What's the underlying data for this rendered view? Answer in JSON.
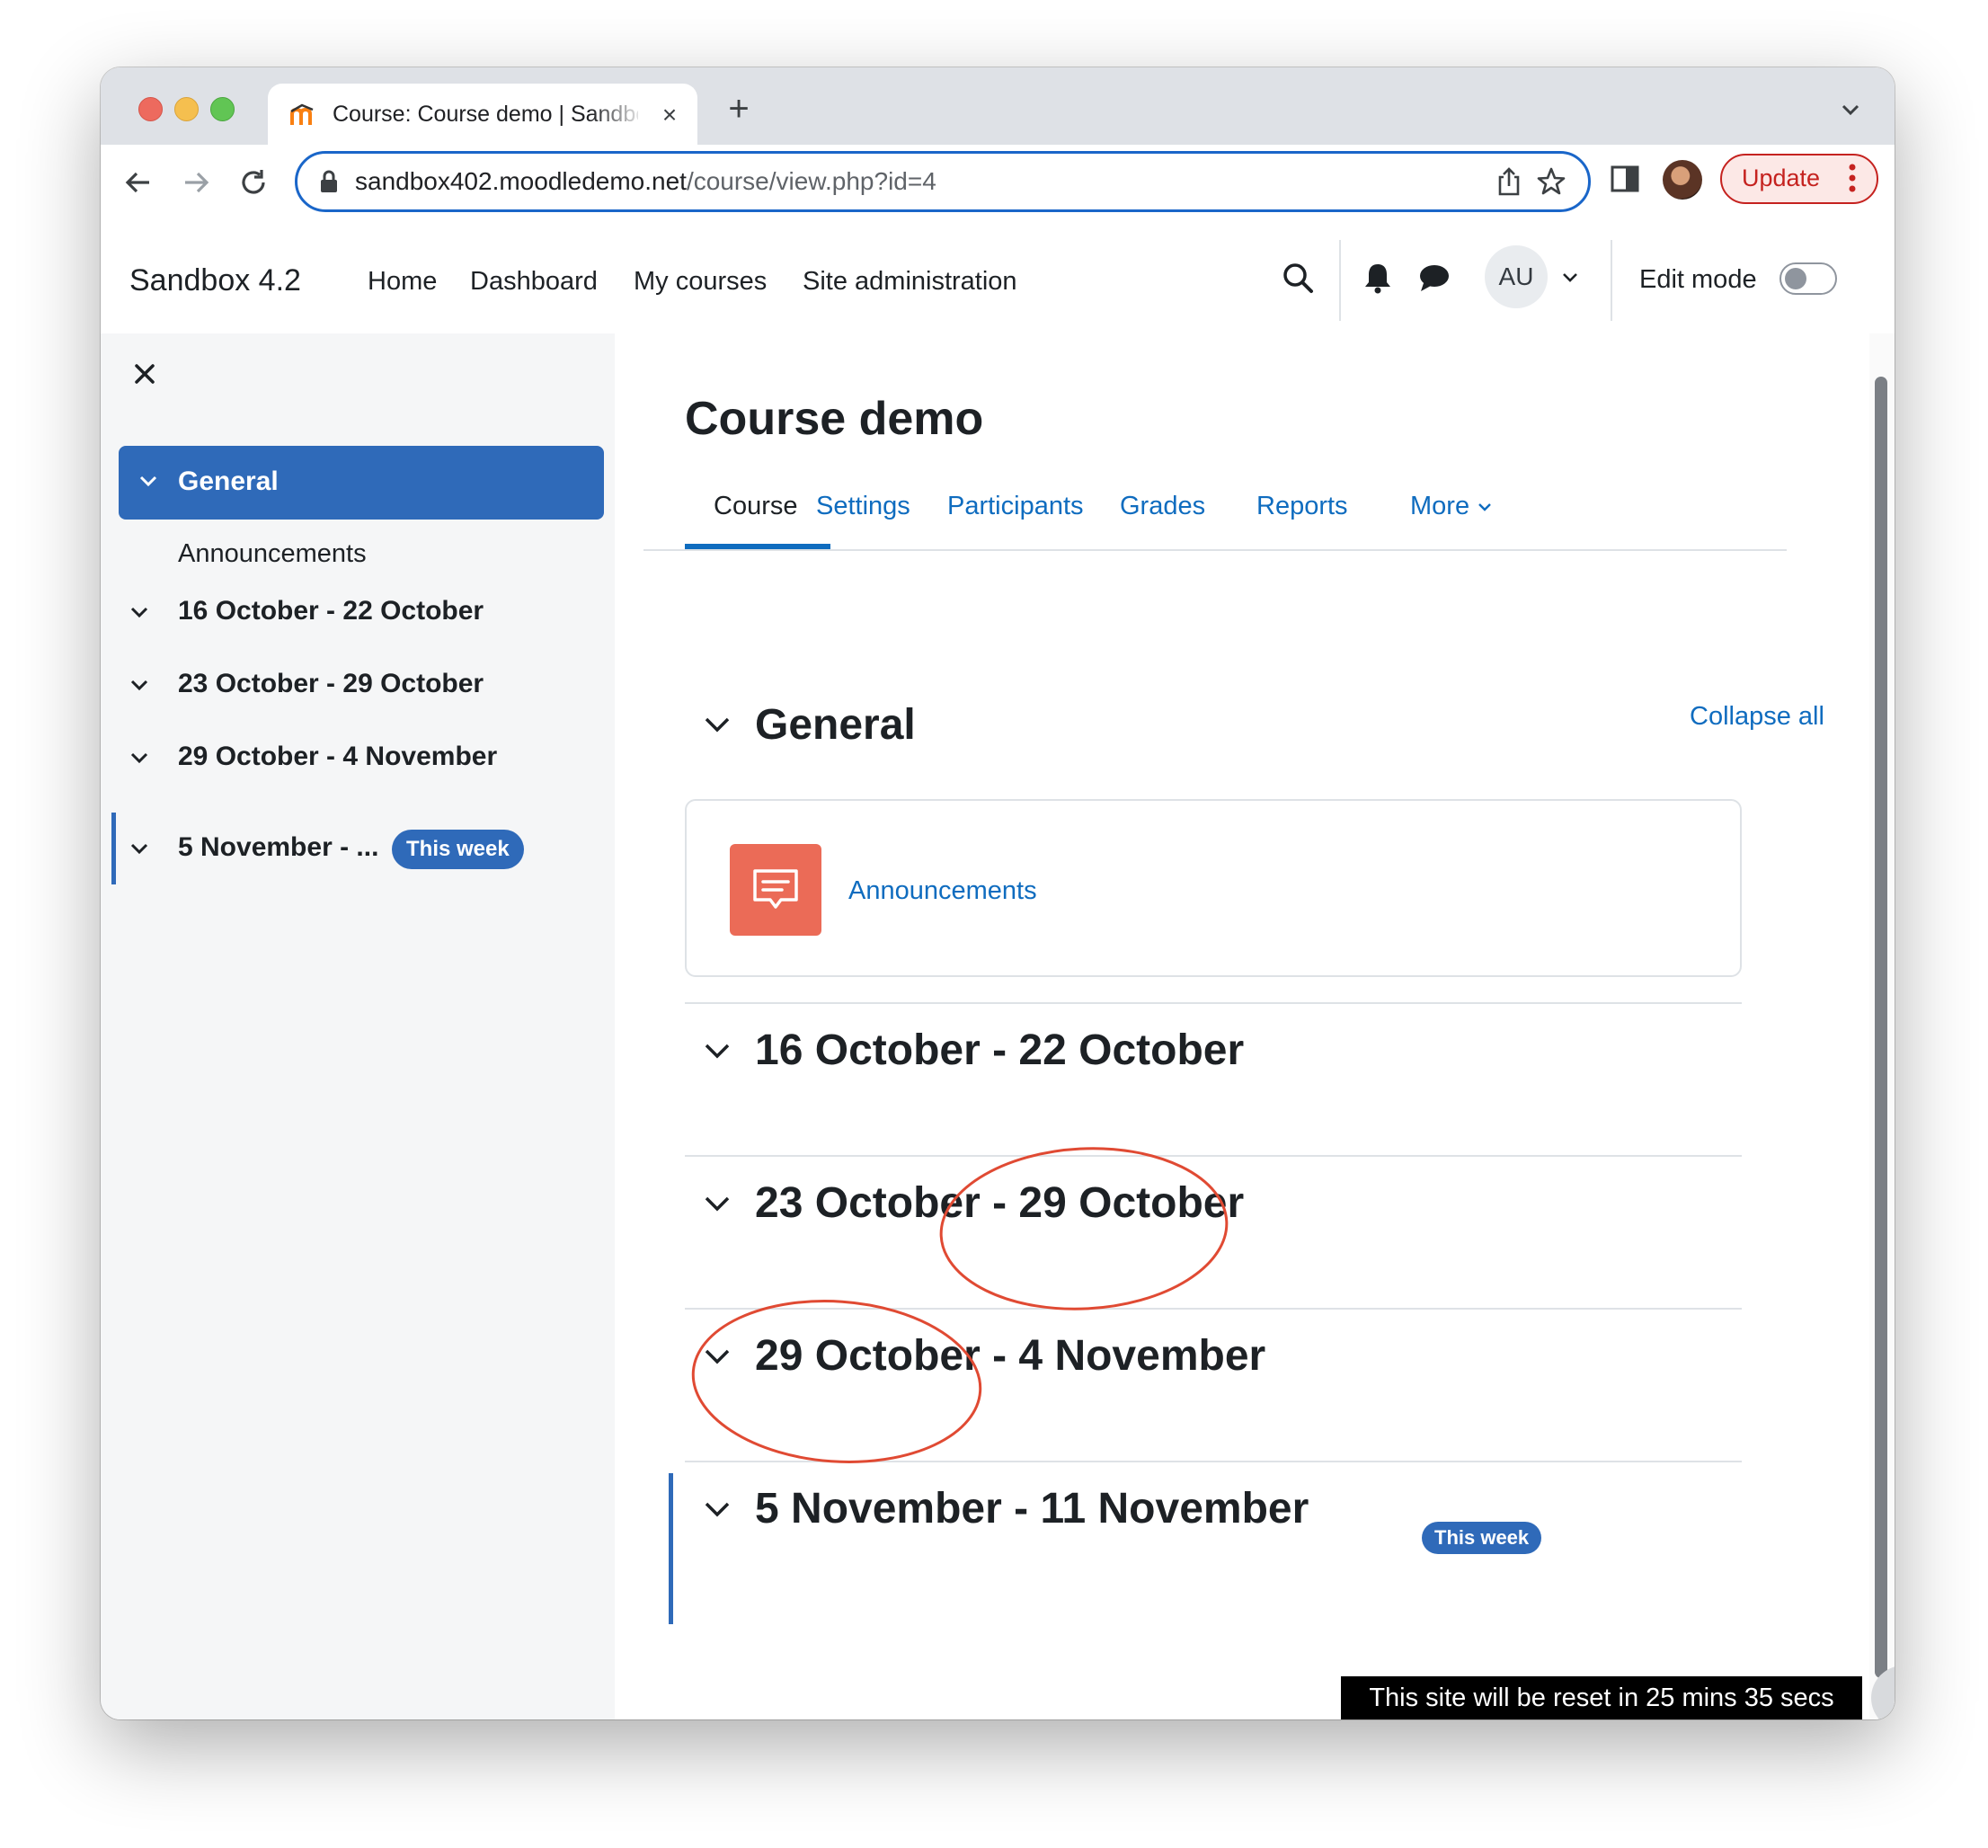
{
  "browser": {
    "tab_title": "Course: Course demo | Sandbox 4.2",
    "url_host": "sandbox402.moodledemo.net",
    "url_path": "/course/view.php?id=4",
    "update_label": "Update",
    "update_color": "#c5221f"
  },
  "navbar": {
    "site_name": "Sandbox 4.2",
    "links": [
      "Home",
      "Dashboard",
      "My courses",
      "Site administration"
    ],
    "user_initials": "AU",
    "edit_mode_label": "Edit mode",
    "edit_mode_on": false
  },
  "course_index": {
    "general": "General",
    "general_items": [
      "Announcements"
    ],
    "sections": [
      "16 October - 22 October",
      "23 October - 29 October",
      "29 October - 4 November",
      "5 November - ..."
    ],
    "current_badge": "This week"
  },
  "course": {
    "title": "Course demo",
    "tabs": [
      "Course",
      "Settings",
      "Participants",
      "Grades",
      "Reports",
      "More"
    ],
    "active_tab": "Course",
    "collapse_all": "Collapse all",
    "general_title": "General",
    "activity_name": "Announcements",
    "sections": [
      "16 October - 22 October",
      "23 October - 29 October",
      "29 October - 4 November",
      "5 November - 11 November"
    ],
    "current_badge": "This week"
  },
  "help_label": "?",
  "reset_notice": "This site will be reset in 25 mins 35 secs",
  "colors": {
    "primary": "#0f6cbf",
    "index_active": "#2f6ab9",
    "activity_icon": "#eb6b57",
    "annotation": "#e04a33"
  }
}
